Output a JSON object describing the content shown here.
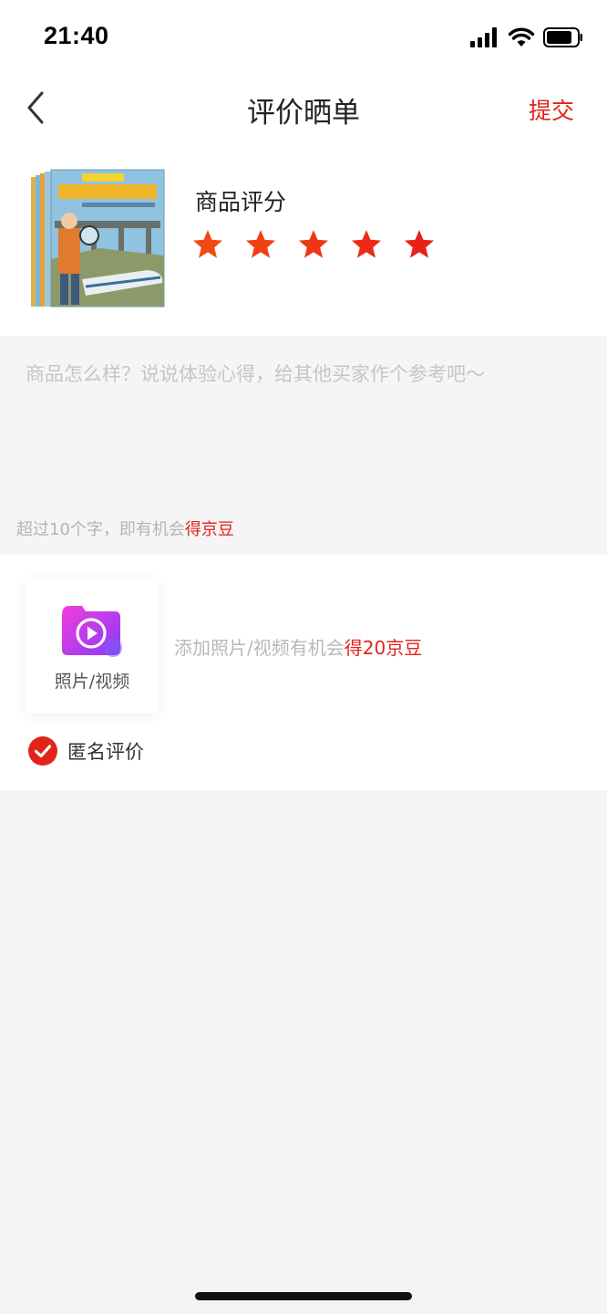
{
  "status_bar": {
    "time": "21:40"
  },
  "nav": {
    "title": "评价晒单",
    "submit_label": "提交"
  },
  "product": {
    "rating_label": "商品评分",
    "rating_value": 5,
    "rating_max": 5,
    "star_color": "#f04a12"
  },
  "review": {
    "placeholder": "商品怎么样？说说体验心得，给其他买家作个参考吧～",
    "hint_prefix": "超过10个字，即有机会",
    "hint_reward": "得京豆"
  },
  "media": {
    "upload_label": "照片/视频",
    "hint_prefix": "添加照片/视频有机会",
    "hint_reward": "得20京豆"
  },
  "anonymous": {
    "label": "匿名评价",
    "checked": true
  },
  "colors": {
    "accent": "#e2231a"
  }
}
